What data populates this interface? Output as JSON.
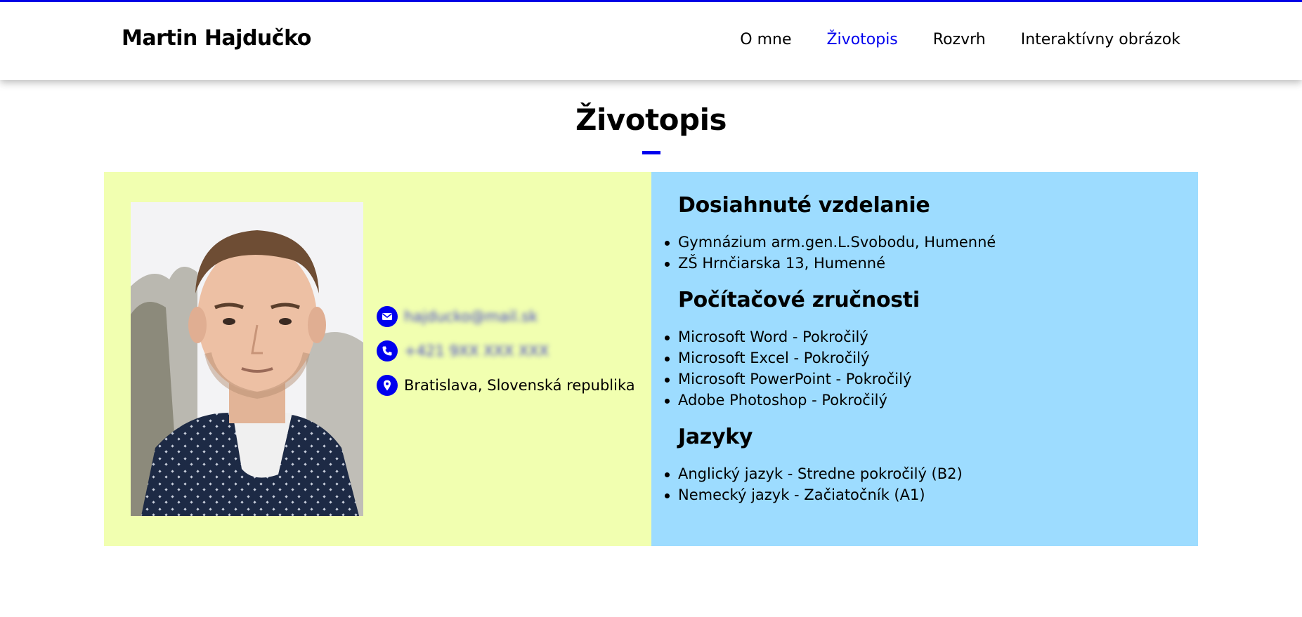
{
  "header": {
    "brand": "Martin Hajdučko",
    "nav": [
      {
        "label": "O mne",
        "active": false
      },
      {
        "label": "Životopis",
        "active": true
      },
      {
        "label": "Rozvrh",
        "active": false
      },
      {
        "label": "Interaktívny obrázok",
        "active": false
      }
    ]
  },
  "page": {
    "title": "Životopis"
  },
  "contact": {
    "email": "hajducko@mail.sk",
    "phone": "+421 9XX XXX XXX",
    "location": "Bratislava, Slovenská republika"
  },
  "sections": [
    {
      "title": "Dosiahnuté vzdelanie",
      "items": [
        "Gymnázium arm.gen.L.Svobodu, Humenné",
        "ZŠ Hrnčiarska 13, Humenné"
      ]
    },
    {
      "title": "Počítačové zručnosti",
      "items": [
        "Microsoft Word - Pokročilý",
        "Microsoft Excel - Pokročilý",
        "Microsoft PowerPoint - Pokročilý",
        "Adobe Photoshop - Pokročilý"
      ]
    },
    {
      "title": "Jazyky",
      "items": [
        "Anglický jazyk - Stredne pokročilý (B2)",
        "Nemecký jazyk - Začiatočník (A1)"
      ]
    }
  ],
  "colors": {
    "accent": "#0000ee",
    "left_panel": "#f1ffb0",
    "right_panel": "#9ddcff"
  },
  "icons": [
    "mail-icon",
    "phone-icon",
    "location-pin-icon"
  ]
}
